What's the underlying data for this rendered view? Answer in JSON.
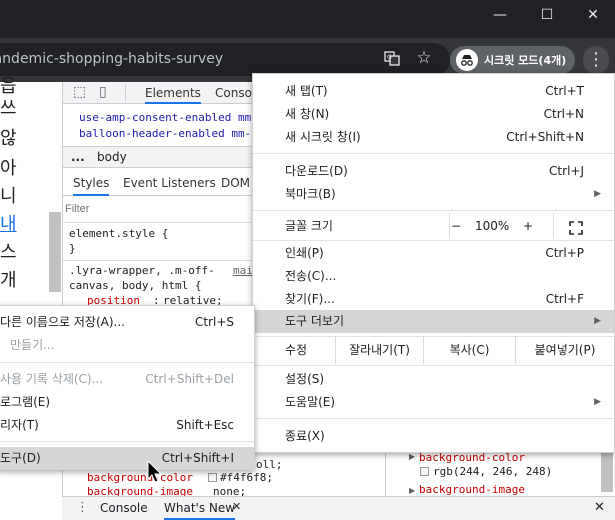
{
  "window": {
    "minimize": "—",
    "maximize": "☐",
    "close": "✕"
  },
  "toolbar": {
    "url": "/pandemic-shopping-habits-survey",
    "incognito_label": "시크릿 모드(4개)",
    "translate_icon": "translate-icon",
    "star_icon": "star-icon",
    "menu_icon": "kebab-menu-icon"
  },
  "page_strip": {
    "chars": [
      "읍",
      "쓰",
      "않",
      "아",
      "니",
      "내",
      "스",
      "개"
    ],
    "link_color": "#1a73e8"
  },
  "devtools": {
    "tabs": [
      "Elements",
      "Console"
    ],
    "html_lines": [
      "use-amp-consent-enabled mm",
      "balloon-header-enabled mm-"
    ],
    "breadcrumb_dots": "...",
    "breadcrumb": "body",
    "style_tabs": [
      "Styles",
      "Event Listeners",
      "DOM"
    ],
    "filter_placeholder": "Filter",
    "rule1_selector": "element.style {",
    "rule1_close": "}",
    "rule2_selector": ".lyra-wrapper, .m-off-",
    "rule2_source": "mai",
    "rule2_selector2": "canvas, body, html {",
    "rule2_prop": "position",
    "rule2_value": "relative;",
    "lower_line1": "oll;",
    "lower_prop_bg": "background-color",
    "lower_val_bg": "#f4f6f8;",
    "lower_prop_img": "background-image",
    "lower_val_img": "none;",
    "computed_prop1": "background-color",
    "computed_val1": "rgb(244, 246, 248)",
    "computed_prop2": "background-image"
  },
  "drawer": {
    "tabs": [
      "Console",
      "What's New"
    ],
    "close_tab": "✕",
    "close_drawer": "✕",
    "menu_dots": "⋮"
  },
  "main_menu": {
    "items": [
      {
        "label": "새 탭(T)",
        "shortcut": "Ctrl+T"
      },
      {
        "label": "새 창(N)",
        "shortcut": "Ctrl+N"
      },
      {
        "label": "새 시크릿 창(I)",
        "shortcut": "Ctrl+Shift+N"
      },
      {
        "label": "다운로드(D)",
        "shortcut": "Ctrl+J"
      },
      {
        "label": "북마크(B)",
        "shortcut": ""
      },
      {
        "label": "인쇄(P)",
        "shortcut": "Ctrl+P"
      },
      {
        "label": "전송(C)...",
        "shortcut": ""
      },
      {
        "label": "찾기(F)...",
        "shortcut": "Ctrl+F"
      },
      {
        "label": "도구 더보기",
        "shortcut": ""
      },
      {
        "label": "설정(S)",
        "shortcut": ""
      },
      {
        "label": "도움말(E)",
        "shortcut": ""
      },
      {
        "label": "종료(X)",
        "shortcut": ""
      }
    ],
    "zoom_label": "글꼴 크기",
    "zoom_minus": "−",
    "zoom_value": "100%",
    "zoom_plus": "+",
    "edit_label": "수정",
    "cut": "잘라내기(T)",
    "copy": "복사(C)",
    "paste": "붙여넣기(P)"
  },
  "sub_menu": {
    "items": [
      {
        "label": "다른 이름으로 저장(A)...",
        "shortcut": "Ctrl+S"
      },
      {
        "label": "만들기...",
        "shortcut": ""
      },
      {
        "label": "사용 기록 삭제(C)...",
        "shortcut": "Ctrl+Shift+Del"
      },
      {
        "label": "로그램(E)",
        "shortcut": ""
      },
      {
        "label": "리자(T)",
        "shortcut": "Shift+Esc"
      },
      {
        "label": "도구(D)",
        "shortcut": "Ctrl+Shift+I"
      }
    ]
  }
}
